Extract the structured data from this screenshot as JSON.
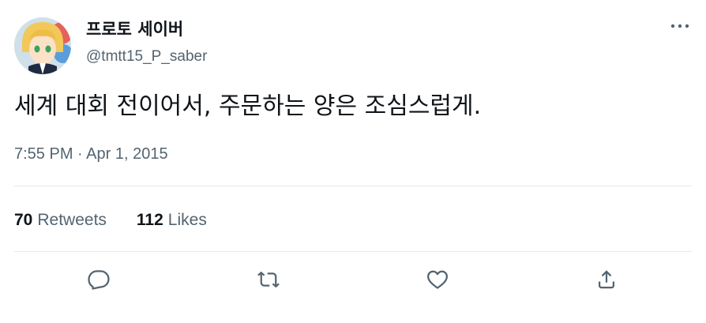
{
  "tweet": {
    "display_name": "프로토 세이버",
    "handle": "@tmtt15_P_saber",
    "text": "세계 대회 전이어서, 주문하는 양은 조심스럽게.",
    "timestamp": "7:55 PM · Apr 1, 2015"
  },
  "stats": {
    "retweets_count": "70",
    "retweets_label": "Retweets",
    "likes_count": "112",
    "likes_label": "Likes"
  },
  "icons": {
    "more": "more-horizontal-icon",
    "reply": "reply-icon",
    "retweet": "retweet-icon",
    "like": "heart-icon",
    "share": "share-icon"
  },
  "colors": {
    "text": "#0f1419",
    "secondary": "#536471",
    "icon": "#536471",
    "divider": "#e4e8eb"
  }
}
